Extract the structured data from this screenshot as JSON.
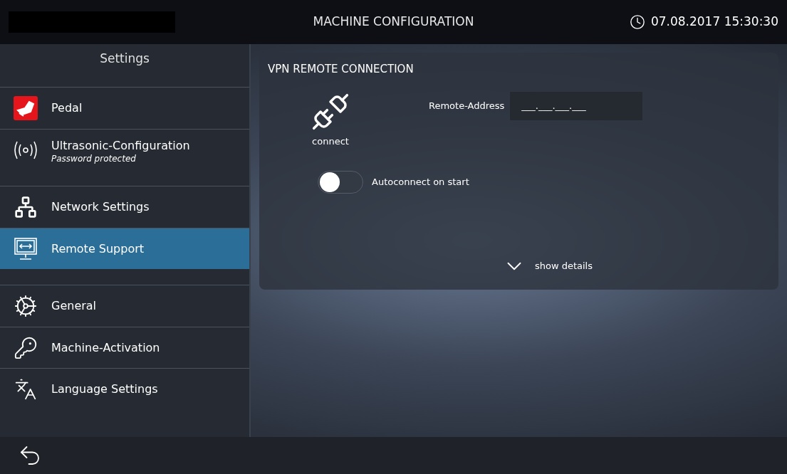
{
  "header": {
    "title": "MACHINE CONFIGURATION",
    "datetime": "07.08.2017 15:30:30"
  },
  "sidebar": {
    "title": "Settings",
    "groups": [
      {
        "items": [
          {
            "kind": "pedal",
            "label": "Pedal",
            "selected": false
          },
          {
            "kind": "ultrasonic",
            "label": "Ultrasonic-Configuration",
            "note": "Password protected",
            "selected": false
          }
        ]
      },
      {
        "items": [
          {
            "kind": "network",
            "label": "Network Settings",
            "selected": false
          },
          {
            "kind": "remote",
            "label": "Remote Support",
            "selected": true
          }
        ]
      },
      {
        "items": [
          {
            "kind": "general",
            "label": "General",
            "selected": false
          },
          {
            "kind": "key",
            "label": "Machine-Activation",
            "selected": false
          },
          {
            "kind": "language",
            "label": "Language Settings",
            "selected": false
          }
        ]
      }
    ]
  },
  "panel": {
    "title": "VPN REMOTE CONNECTION",
    "connect_label": "connect",
    "address_label": "Remote-Address",
    "address_placeholder": "___.___.___.___",
    "autoconnect": {
      "label": "Autoconnect on start",
      "on": false
    },
    "details_label": "show details"
  }
}
